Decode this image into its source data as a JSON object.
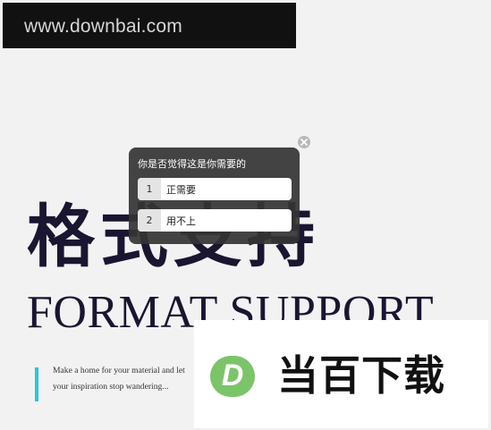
{
  "site_banner": {
    "text": "www.downbai.com"
  },
  "hero": {
    "title_cn": "格式支持",
    "title_en": "FORMAT SUPPORT"
  },
  "tagline": {
    "line1": "Make a home for your material and let",
    "line2": "your inspiration stop wandering..."
  },
  "poll": {
    "question": "你是否觉得这是你需要的",
    "options": [
      {
        "number": "1",
        "label": "正需要"
      },
      {
        "number": "2",
        "label": "用不上"
      }
    ],
    "close_icon": "close-icon"
  },
  "brand_logo": {
    "letter": "D",
    "text": "当百下载",
    "colors": {
      "green": "#7cc46a",
      "text": "#111111"
    }
  },
  "colors": {
    "page_background": "#f2f2f2",
    "banner_background": "#111111",
    "headline": "#1a1530",
    "accent": "#2ec4e0",
    "popup_background": "#343434"
  }
}
